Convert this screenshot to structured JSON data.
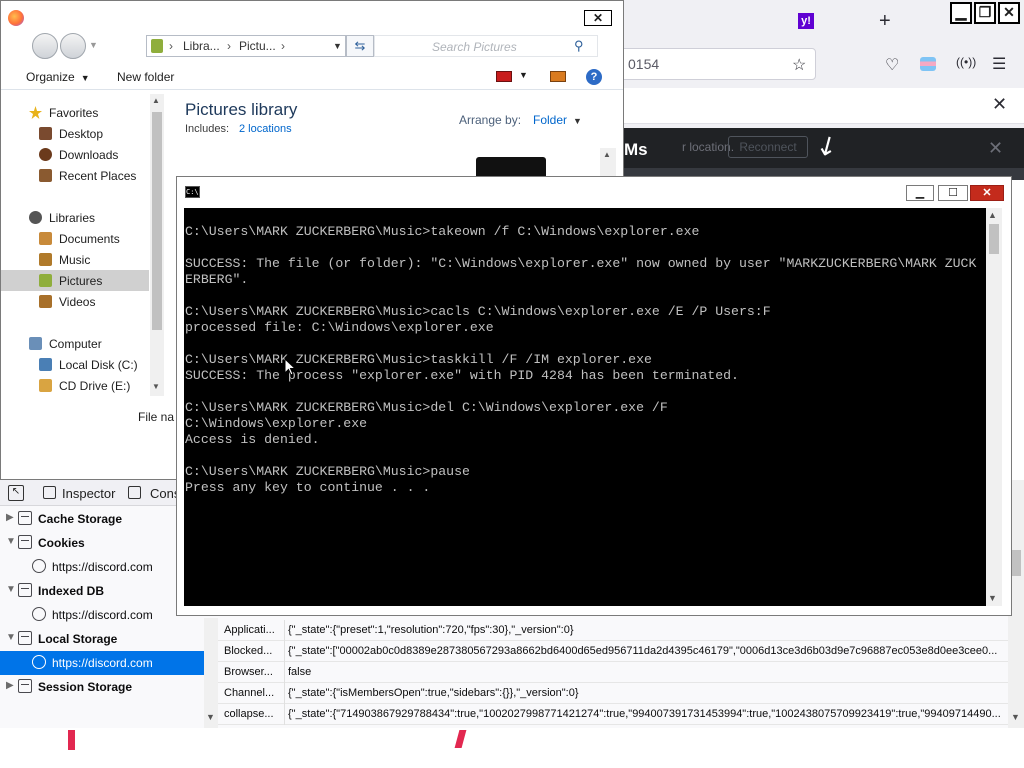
{
  "firefox": {
    "url_fragment": "0154",
    "discord_title": "Ms",
    "discord_location": "r location.",
    "reconnect_label": "Reconnect",
    "new_tab_symbol": "+"
  },
  "explorer": {
    "breadcrumb": [
      "Libra...",
      "Pictu..."
    ],
    "search_placeholder": "Search Pictures",
    "organize_label": "Organize",
    "new_folder_label": "New folder",
    "library_title": "Pictures library",
    "includes_label": "Includes:",
    "locations_link": "2 locations",
    "arrange_label": "Arrange by:",
    "arrange_value": "Folder",
    "filename_label": "File na",
    "nav": {
      "favorites": "Favorites",
      "desktop": "Desktop",
      "downloads": "Downloads",
      "recent_places": "Recent Places",
      "libraries": "Libraries",
      "documents": "Documents",
      "music": "Music",
      "pictures": "Pictures",
      "videos": "Videos",
      "computer": "Computer",
      "local_disk": "Local Disk (C:)",
      "cd_drive": "CD Drive (E:)"
    }
  },
  "cmd": {
    "title_icon": "C:\\",
    "lines": [
      "C:\\Users\\MARK ZUCKERBERG\\Music>takeown /f C:\\Windows\\explorer.exe",
      "",
      "SUCCESS: The file (or folder): \"C:\\Windows\\explorer.exe\" now owned by user \"MARKZUCKERBERG\\MARK ZUCK",
      "ERBERG\".",
      "",
      "C:\\Users\\MARK ZUCKERBERG\\Music>cacls C:\\Windows\\explorer.exe /E /P Users:F",
      "processed file: C:\\Windows\\explorer.exe",
      "",
      "C:\\Users\\MARK ZUCKERBERG\\Music>taskkill /F /IM explorer.exe",
      "SUCCESS: The process \"explorer.exe\" with PID 4284 has been terminated.",
      "",
      "C:\\Users\\MARK ZUCKERBERG\\Music>del C:\\Windows\\explorer.exe /F",
      "C:\\Windows\\explorer.exe",
      "Access is denied.",
      "",
      "C:\\Users\\MARK ZUCKERBERG\\Music>pause",
      "Press any key to continue . . ."
    ]
  },
  "devtools": {
    "inspector_label": "Inspector",
    "console_label": "Cons",
    "tree": {
      "cache_storage": "Cache Storage",
      "cookies": "Cookies",
      "cookies_child": "https://discord.com",
      "indexed_db": "Indexed DB",
      "indexed_db_child": "https://discord.com",
      "local_storage": "Local Storage",
      "local_storage_child": "https://discord.com",
      "session_storage": "Session Storage"
    },
    "rows": [
      {
        "key": "Applicati...",
        "value": "{\"_state\":{\"preset\":1,\"resolution\":720,\"fps\":30},\"_version\":0}"
      },
      {
        "key": "Blocked...",
        "value": "{\"_state\":[\"00002ab0c0d8389e287380567293a8662bd6400d65ed956711da2d4395c46179\",\"0006d13ce3d6b03d9e7c96887ec053e8d0ee3cee0..."
      },
      {
        "key": "Browser...",
        "value": "false"
      },
      {
        "key": "Channel...",
        "value": "{\"_state\":{\"isMembersOpen\":true,\"sidebars\":{}},\"_version\":0}"
      },
      {
        "key": "collapse...",
        "value": "{\"_state\":{\"714903867929788434\":true,\"1002027998771421274\":true,\"994007391731453994\":true,\"1002438075709923419\":true,\"99409714490..."
      }
    ]
  }
}
